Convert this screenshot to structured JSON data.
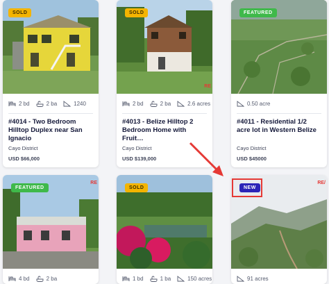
{
  "listings": [
    {
      "badge": "SOLD",
      "beds": "2 bd",
      "baths": "2 ba",
      "area": "1240",
      "title": "#4014 - Two Bedroom Hilltop Duplex near San Ignacio",
      "district": "Cayo District",
      "price": "USD $66,000"
    },
    {
      "badge": "SOLD",
      "beds": "2 bd",
      "baths": "2 ba",
      "area": "2.6 acres",
      "title": "#4013 - Belize Hilltop 2 Bedroom Home with Fruit…",
      "district": "Cayo District",
      "price": "USD $139,000",
      "brand": "RE"
    },
    {
      "badge": "FEATURED",
      "area": "0.50 acre",
      "title": "#4011 - Residential 1/2 acre lot in Western Belize",
      "district": "Cayo District",
      "price": "USD $45000"
    },
    {
      "badge": "FEATURED",
      "beds": "4 bd",
      "baths": "2 ba",
      "brand": "RE"
    },
    {
      "badge": "SOLD",
      "beds": "1 bd",
      "baths": "1 ba",
      "area": "150 acres"
    },
    {
      "badge": "NEW",
      "area": "91 acres",
      "brand": "RE/"
    }
  ],
  "colors": {
    "sold": "#f4b400",
    "featured": "#3fb94a",
    "new": "#2c25b8",
    "annotation": "#e53935"
  },
  "icons": [
    "bed-icon",
    "bath-icon",
    "area-icon",
    "arrow-annotation-icon"
  ]
}
